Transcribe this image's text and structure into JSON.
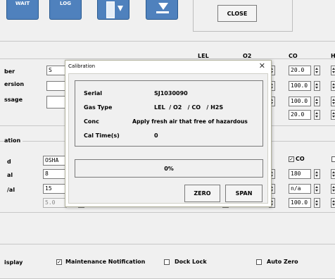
{
  "toolbar": {
    "wait_label": "WAIT",
    "log_label": "LOG",
    "close_label": "CLOSE"
  },
  "config": {
    "labels": [
      "ber",
      "ersion",
      "ssage"
    ],
    "serial_partial": "S"
  },
  "columns": {
    "lel": "LEL",
    "o2": "O2",
    "co": "CO",
    "h_partial": "H"
  },
  "co_values": [
    "20.0",
    "100.0",
    "100.0",
    "20.0"
  ],
  "section2": {
    "title": "ation",
    "labels": [
      "d",
      "al",
      "/al"
    ],
    "mode_value": "OSHA",
    "value_8": "8",
    "value_15": "15",
    "value_50": "5.0",
    "co_check_label": "CO",
    "co_values": [
      "180",
      "n/a",
      "100.0"
    ]
  },
  "bottom": {
    "display_label": "isplay",
    "maintenance_label": "Maintenance Notification",
    "dock_lock_label": "Dock Lock",
    "auto_zero_label": "Auto Zero"
  },
  "dialog": {
    "title": "Calibration",
    "serial_label": "Serial",
    "serial_value": "SJ1030090",
    "gas_type_label": "Gas Type",
    "gas_type_value": "LEL  / O2   / CO   / H2S",
    "conc_label": "Conc",
    "conc_value": "Apply fresh air that free of hazardous",
    "cal_time_label": "Cal Time(s)",
    "cal_time_value": "0",
    "progress_text": "0%",
    "progress": 0,
    "zero_label": "ZERO",
    "span_label": "SPAN"
  }
}
